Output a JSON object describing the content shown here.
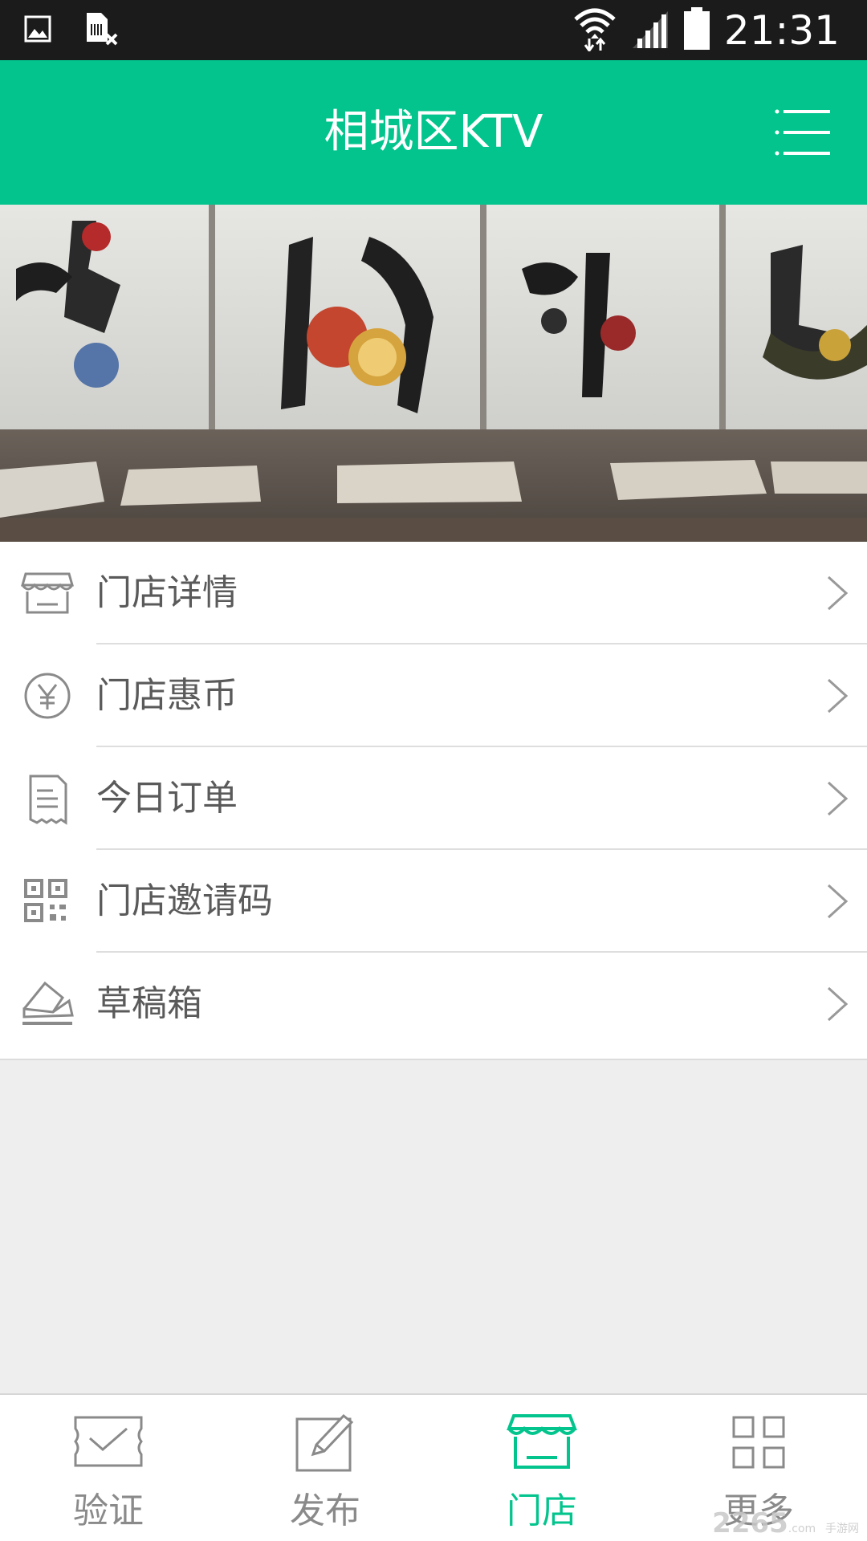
{
  "status_bar": {
    "time": "21:31",
    "icons": [
      "image-icon",
      "sim-missing-icon",
      "wifi-icon",
      "signal-icon",
      "battery-icon"
    ]
  },
  "header": {
    "title": "相城区KTV",
    "menu_icon": "menu-list-icon"
  },
  "banner": {
    "image": "restaurant-interior-calligraphy-photo"
  },
  "menu": {
    "items": [
      {
        "label": "门店详情",
        "icon": "store-icon"
      },
      {
        "label": "门店惠币",
        "icon": "yen-coin-icon"
      },
      {
        "label": "今日订单",
        "icon": "receipt-icon"
      },
      {
        "label": "门店邀请码",
        "icon": "qr-code-icon"
      },
      {
        "label": "草稿箱",
        "icon": "draft-box-icon"
      }
    ]
  },
  "tabs": {
    "items": [
      {
        "label": "验证",
        "icon": "ticket-check-icon",
        "active": false
      },
      {
        "label": "发布",
        "icon": "edit-icon",
        "active": false
      },
      {
        "label": "门店",
        "icon": "store-icon",
        "active": true
      },
      {
        "label": "更多",
        "icon": "grid-icon",
        "active": false
      }
    ]
  },
  "watermark": {
    "text": "2265",
    "suffix": ".com",
    "sub": "手游网"
  },
  "colors": {
    "accent": "#04c48d",
    "status_bar": "#1b1b1b",
    "background": "#eeeeee",
    "text_gray": "#5a5a5a",
    "tab_inactive": "#8a8a8a"
  }
}
